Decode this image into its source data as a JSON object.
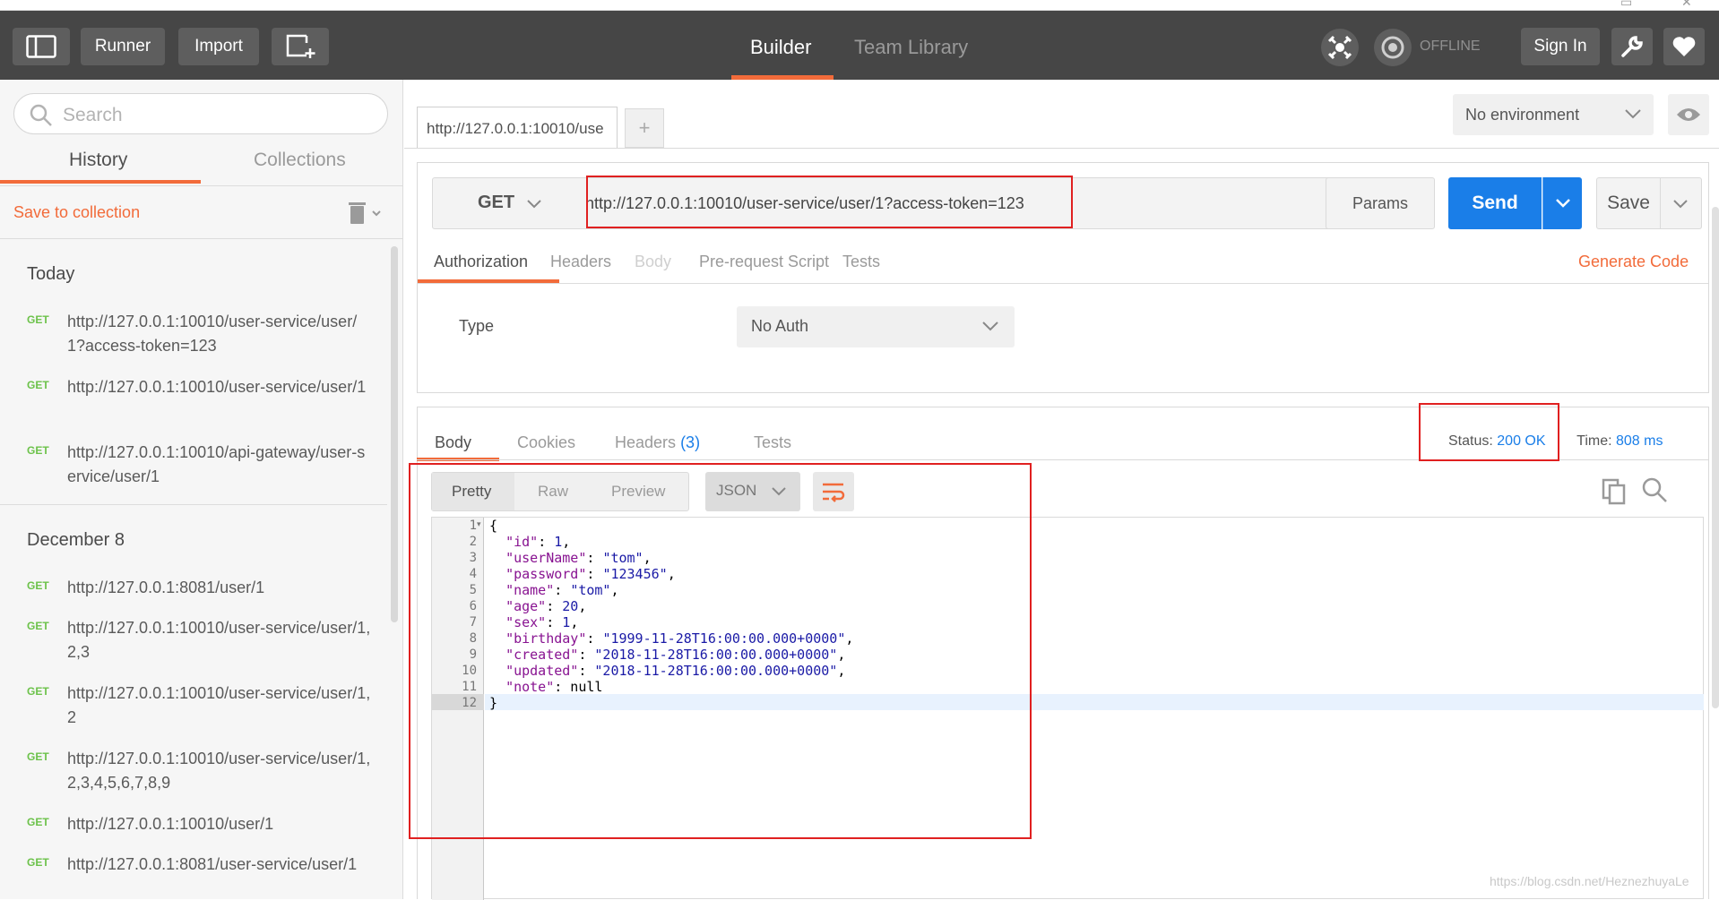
{
  "header": {
    "runner_label": "Runner",
    "import_label": "Import",
    "builder_tab": "Builder",
    "team_library_tab": "Team Library",
    "offline_label": "OFFLINE",
    "sign_in_label": "Sign In"
  },
  "sidebar": {
    "search_placeholder": "Search",
    "tabs": [
      "History",
      "Collections"
    ],
    "save_to_collection": "Save to collection",
    "groups": [
      {
        "title": "Today",
        "items": [
          {
            "method": "GET",
            "url": "http://127.0.0.1:10010/user-service/user/1?access-token=123"
          },
          {
            "method": "GET",
            "url": "http://127.0.0.1:10010/user-service/user/1"
          },
          {
            "method": "GET",
            "url": "http://127.0.0.1:10010/api-gateway/user-service/user/1"
          }
        ]
      },
      {
        "title": "December 8",
        "items": [
          {
            "method": "GET",
            "url": "http://127.0.0.1:8081/user/1"
          },
          {
            "method": "GET",
            "url": "http://127.0.0.1:10010/user-service/user/1,2,3"
          },
          {
            "method": "GET",
            "url": "http://127.0.0.1:10010/user-service/user/1,2"
          },
          {
            "method": "GET",
            "url": "http://127.0.0.1:10010/user-service/user/1,2,3,4,5,6,7,8,9"
          },
          {
            "method": "GET",
            "url": "http://127.0.0.1:10010/user/1"
          },
          {
            "method": "GET",
            "url": "http://127.0.0.1:8081/user-service/user/1"
          }
        ]
      }
    ]
  },
  "request": {
    "tab_title": "http://127.0.0.1:10010/use",
    "environment": "No environment",
    "method": "GET",
    "url": "http://127.0.0.1:10010/user-service/user/1?access-token=123",
    "params_label": "Params",
    "send_label": "Send",
    "save_label": "Save",
    "tabs": [
      "Authorization",
      "Headers",
      "Body",
      "Pre-request Script",
      "Tests"
    ],
    "generate_code": "Generate Code",
    "auth_type_label": "Type",
    "auth_type_value": "No Auth"
  },
  "response": {
    "tabs": [
      "Body",
      "Cookies",
      "Headers",
      "Tests"
    ],
    "headers_count": "(3)",
    "status_label": "Status:",
    "status_value": "200 OK",
    "time_label": "Time:",
    "time_value": "808 ms",
    "formats": [
      "Pretty",
      "Raw",
      "Preview"
    ],
    "language": "JSON",
    "body_lines": [
      "{",
      "  \"id\": 1,",
      "  \"userName\": \"tom\",",
      "  \"password\": \"123456\",",
      "  \"name\": \"tom\",",
      "  \"age\": 20,",
      "  \"sex\": 1,",
      "  \"birthday\": \"1999-11-28T16:00:00.000+0000\",",
      "  \"created\": \"2018-11-28T16:00:00.000+0000\",",
      "  \"updated\": \"2018-11-28T16:00:00.000+0000\",",
      "  \"note\": null",
      "}"
    ]
  },
  "watermark": "https://blog.csdn.net/HeznezhuyaLe",
  "colors": {
    "accent": "#f26b3a",
    "send_blue": "#1a7ee8",
    "get_green": "#6cc24a",
    "header_bg": "#464646"
  }
}
